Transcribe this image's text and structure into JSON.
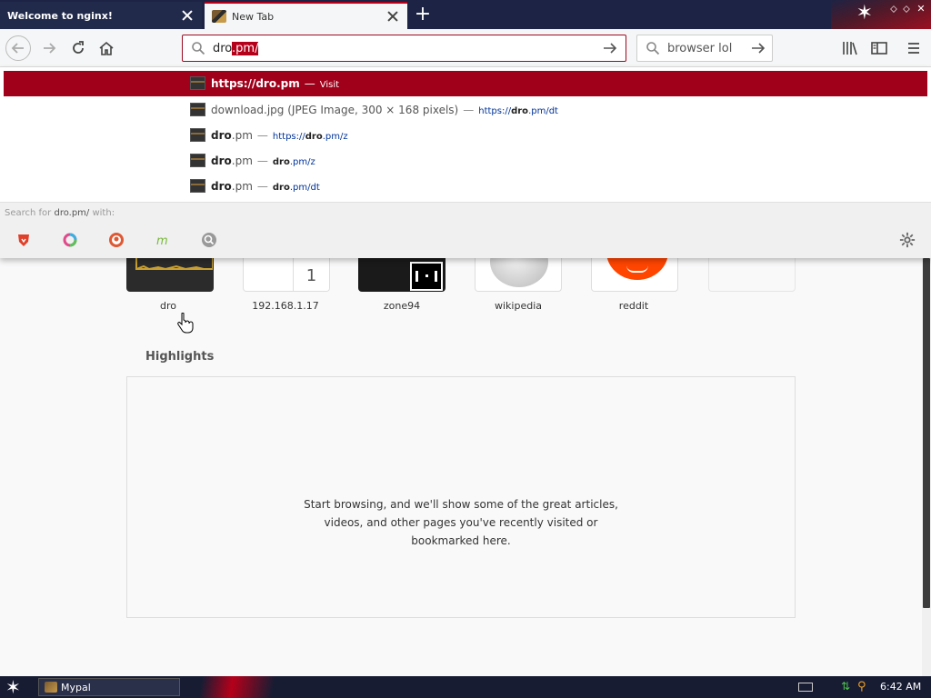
{
  "tabs": [
    {
      "title": "Welcome to nginx!",
      "active": false
    },
    {
      "title": "New Tab",
      "active": true
    }
  ],
  "navbar": {
    "url_typed": "dro",
    "url_autofill": ".pm/",
    "search_text": "browser lol"
  },
  "autocomplete": {
    "results": [
      {
        "title_bold": "https://dro.pm",
        "title_rest": "",
        "sep": "—",
        "action": "Visit",
        "selected": true
      },
      {
        "title_bold": "",
        "title_rest": "download.jpg (JPEG Image, 300 × 168 pixels)",
        "sep": "—",
        "url_pre": "https://",
        "url_bold": "dro",
        "url_post": ".pm/dt"
      },
      {
        "title_bold": "dro",
        "title_rest": ".pm",
        "sep": "—",
        "url_pre": "https://",
        "url_bold": "dro",
        "url_post": ".pm/z"
      },
      {
        "title_bold": "dro",
        "title_rest": ".pm",
        "sep": "—",
        "url_pre": "",
        "url_bold": "dro",
        "url_post": ".pm/z"
      },
      {
        "title_bold": "dro",
        "title_rest": ".pm",
        "sep": "—",
        "url_pre": "",
        "url_bold": "dro",
        "url_post": ".pm/dt"
      }
    ],
    "search_with_prefix": "Search for ",
    "search_with_query": "dro.pm/",
    "search_with_suffix": " with:"
  },
  "topsites": [
    {
      "label": "dro"
    },
    {
      "label": "192.168.1.17",
      "badge": "1"
    },
    {
      "label": "zone94"
    },
    {
      "label": "wikipedia"
    },
    {
      "label": "reddit"
    }
  ],
  "highlights": {
    "title": "Highlights",
    "message_line1": "Start browsing, and we'll show some of the great articles,",
    "message_line2": "videos, and other pages you've recently visited or",
    "message_line3": "bookmarked here."
  },
  "taskbar": {
    "app_label": "Mypal",
    "clock": "6:42 AM"
  },
  "colors": {
    "accent": "#a0001a",
    "tabbar": "#1d2344",
    "taskbar": "#171c33"
  }
}
